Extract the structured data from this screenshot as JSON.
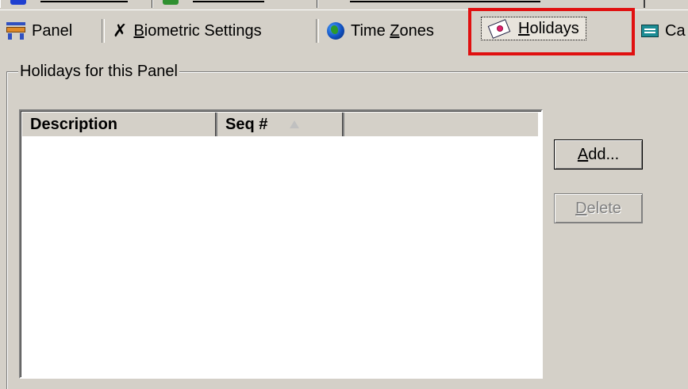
{
  "tabs": [
    {
      "label": "Panel",
      "underline": "",
      "icon": "panel-icon"
    },
    {
      "label_pre": "",
      "underline": "B",
      "label_post": "iometric Settings",
      "icon": "biometric-icon"
    },
    {
      "label_pre": "Time ",
      "underline": "Z",
      "label_post": "ones",
      "icon": "globe-icon"
    },
    {
      "label_pre": "",
      "underline": "H",
      "label_post": "olidays",
      "icon": "holiday-icon",
      "active": true
    },
    {
      "label": "Ca",
      "icon": "card-icon"
    }
  ],
  "group": {
    "legend": "Holidays for this Panel"
  },
  "list": {
    "columns": [
      {
        "label": "Description"
      },
      {
        "label": "Seq #",
        "sorted": "ascending"
      }
    ]
  },
  "buttons": {
    "add": {
      "underline": "A",
      "rest": "dd..."
    },
    "delete": {
      "underline": "D",
      "rest": "elete",
      "disabled": true
    }
  },
  "colors": {
    "highlight": "#e01010",
    "background": "#d4d0c8"
  }
}
